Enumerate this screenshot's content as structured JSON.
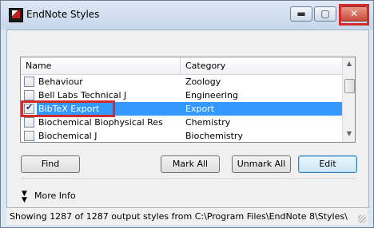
{
  "window": {
    "title": "EndNote Styles"
  },
  "titlebar_buttons": {
    "minimize": "▬",
    "maximize": "▢",
    "close": "✕"
  },
  "list": {
    "columns": [
      "Name",
      "Category"
    ],
    "rows": [
      {
        "name": "Behaviour",
        "category": "Zoology",
        "checked": false,
        "selected": false
      },
      {
        "name": "Bell Labs Technical J",
        "category": "Engineering",
        "checked": false,
        "selected": false
      },
      {
        "name": "BibTeX Export",
        "category": "Export",
        "checked": true,
        "selected": true
      },
      {
        "name": "Biochemical Biophysical Res",
        "category": "Chemistry",
        "checked": false,
        "selected": false
      },
      {
        "name": "Biochemical J",
        "category": "Biochemistry",
        "checked": false,
        "selected": false
      }
    ]
  },
  "buttons": {
    "find": "Find",
    "mark_all": "Mark All",
    "unmark_all": "Unmark All",
    "edit": "Edit"
  },
  "more_info": {
    "icon": "double-chevron-down-icon",
    "label": "More Info"
  },
  "status": "Showing 1287 of 1287 output styles from C:\\Program Files\\EndNote 8\\Styles\\",
  "colors": {
    "selection": "#3399ff",
    "annotation": "#d42a2a"
  }
}
